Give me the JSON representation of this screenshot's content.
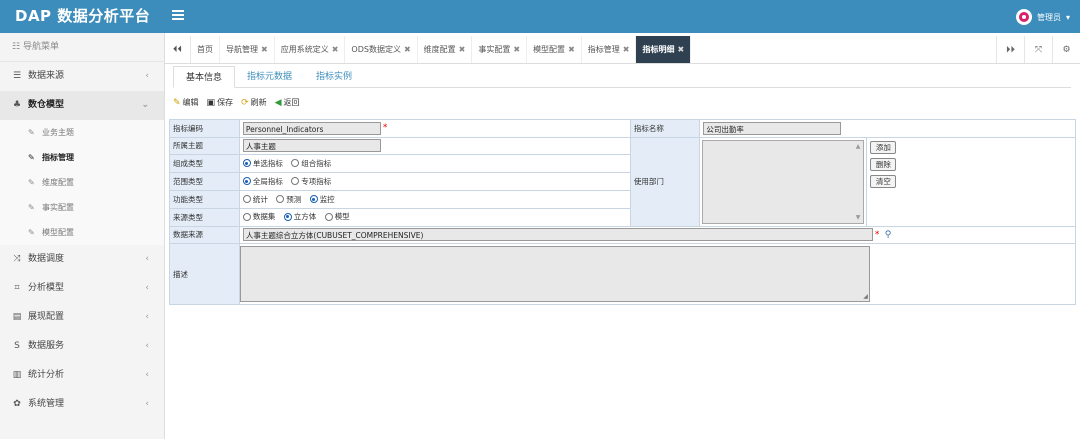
{
  "app": {
    "title": "DAP 数据分析平台",
    "user": "管理员"
  },
  "sidebar": {
    "header": "导航菜单",
    "items": [
      {
        "label": "数据来源",
        "icon": "database-icon"
      },
      {
        "label": "数仓模型",
        "icon": "cubes-icon"
      },
      {
        "label": "数据调度",
        "icon": "shuffle-icon"
      },
      {
        "label": "分析模型",
        "icon": "model-icon"
      },
      {
        "label": "展现配置",
        "icon": "display-icon"
      },
      {
        "label": "数据服务",
        "icon": "service-icon"
      },
      {
        "label": "统计分析",
        "icon": "bar-chart-icon"
      },
      {
        "label": "系统管理",
        "icon": "gear-icon"
      }
    ],
    "subitems": [
      {
        "label": "业务主题"
      },
      {
        "label": "指标管理"
      },
      {
        "label": "维度配置"
      },
      {
        "label": "事实配置"
      },
      {
        "label": "模型配置"
      }
    ]
  },
  "tabs": [
    {
      "label": "首页"
    },
    {
      "label": "导航管理"
    },
    {
      "label": "应用系统定义"
    },
    {
      "label": "ODS数据定义"
    },
    {
      "label": "维度配置"
    },
    {
      "label": "事实配置"
    },
    {
      "label": "模型配置"
    },
    {
      "label": "指标管理"
    },
    {
      "label": "指标明细"
    }
  ],
  "subtabs": [
    "基本信息",
    "指标元数据",
    "指标实例"
  ],
  "toolbar": {
    "edit": "编辑",
    "save": "保存",
    "refresh": "刷新",
    "back": "返回"
  },
  "form": {
    "code_label": "指标编码",
    "code_value": "Personnel_Indicators",
    "name_label": "指标名称",
    "name_value": "公司出勤率",
    "theme_label": "所属主题",
    "theme_value": "人事主题",
    "compose_label": "组成类型",
    "compose_opt1": "单选指标",
    "compose_opt2": "组合指标",
    "scope_label": "范围类型",
    "scope_opt1": "全局指标",
    "scope_opt2": "专项指标",
    "func_label": "功能类型",
    "func_opt1": "统计",
    "func_opt2": "预测",
    "func_opt3": "监控",
    "source_type_label": "来源类型",
    "source_opt1": "数据集",
    "source_opt2": "立方体",
    "source_opt3": "模型",
    "dept_label": "使用部门",
    "add_btn": "添加",
    "del_btn": "删除",
    "clear_btn": "清空",
    "datasource_label": "数据来源",
    "datasource_value": "人事主题综合立方体(CUBUSET_COMPREHENSIVE)",
    "desc_label": "描述",
    "desc_value": ""
  },
  "colors": {
    "topbar": "#3c8dbc",
    "active_tab": "#2f4050",
    "label_bg": "#e3ecf7"
  }
}
